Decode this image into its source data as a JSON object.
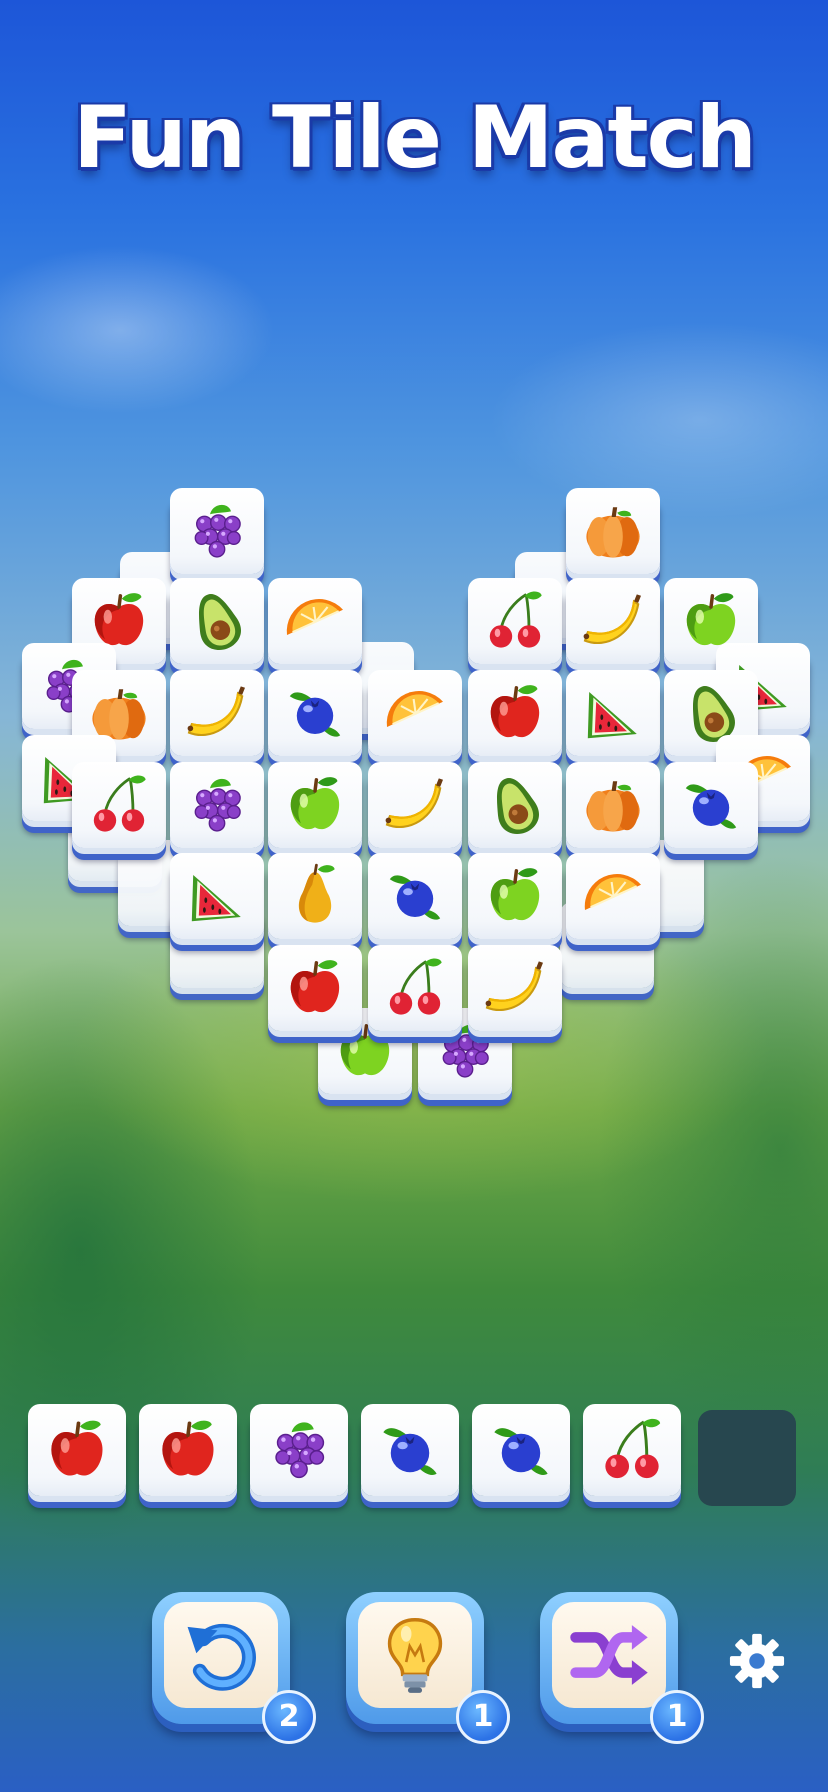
{
  "title": "Fun Tile Match",
  "board": {
    "tiles": [
      {
        "fruit": "grapes",
        "layer": "top"
      },
      {
        "fruit": "pumpkin",
        "layer": "top"
      },
      {
        "fruit": "apple",
        "layer": "top"
      },
      {
        "fruit": "avocado",
        "layer": "top"
      },
      {
        "fruit": "orange",
        "layer": "top"
      },
      {
        "fruit": "cherry",
        "layer": "top"
      },
      {
        "fruit": "banana",
        "layer": "top"
      },
      {
        "fruit": "green-apple",
        "layer": "top"
      },
      {
        "fruit": "grapes",
        "layer": "partial"
      },
      {
        "fruit": "pumpkin",
        "layer": "top"
      },
      {
        "fruit": "banana",
        "layer": "top"
      },
      {
        "fruit": "blueberry",
        "layer": "top"
      },
      {
        "fruit": "orange",
        "layer": "top"
      },
      {
        "fruit": "apple",
        "layer": "top"
      },
      {
        "fruit": "watermelon",
        "layer": "top"
      },
      {
        "fruit": "avocado",
        "layer": "top"
      },
      {
        "fruit": "watermelon",
        "layer": "partial"
      },
      {
        "fruit": "watermelon",
        "layer": "partial"
      },
      {
        "fruit": "cherry",
        "layer": "top"
      },
      {
        "fruit": "grapes",
        "layer": "top"
      },
      {
        "fruit": "green-apple",
        "layer": "top"
      },
      {
        "fruit": "banana",
        "layer": "top"
      },
      {
        "fruit": "avocado",
        "layer": "top"
      },
      {
        "fruit": "pumpkin",
        "layer": "top"
      },
      {
        "fruit": "blueberry",
        "layer": "top"
      },
      {
        "fruit": "orange",
        "layer": "partial"
      },
      {
        "fruit": "watermelon",
        "layer": "top"
      },
      {
        "fruit": "pear",
        "layer": "top"
      },
      {
        "fruit": "blueberry",
        "layer": "top"
      },
      {
        "fruit": "green-apple",
        "layer": "top"
      },
      {
        "fruit": "orange",
        "layer": "top"
      },
      {
        "fruit": "apple",
        "layer": "top"
      },
      {
        "fruit": "cherry",
        "layer": "top"
      },
      {
        "fruit": "banana",
        "layer": "top"
      },
      {
        "fruit": "green-apple",
        "layer": "partial"
      },
      {
        "fruit": "grapes",
        "layer": "partial"
      }
    ]
  },
  "tray": {
    "capacity": 7,
    "slots": [
      "apple",
      "apple",
      "grapes",
      "blueberry",
      "blueberry",
      "cherry",
      ""
    ]
  },
  "powerups": [
    {
      "name": "undo",
      "icon": "undo-arrow-icon",
      "count": "2"
    },
    {
      "name": "hint",
      "icon": "lightbulb-icon",
      "count": "1"
    },
    {
      "name": "shuffle",
      "icon": "shuffle-icon",
      "count": "1"
    }
  ],
  "settings_icon": "gear-icon",
  "colors": {
    "tile_border": "#3f63c9",
    "title_outline": "#1a3aa8",
    "badge": "#2c72e6",
    "empty_slot": "#27474f"
  }
}
